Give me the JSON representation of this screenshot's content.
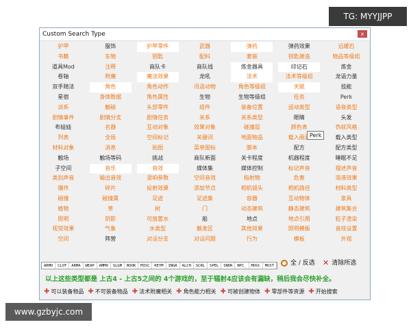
{
  "watermark_top": "TG: MYYJJPP",
  "watermark_bottom": "www.gzbyjc.com",
  "window": {
    "title": "Custom Search Type",
    "close": "x"
  },
  "rows": [
    [
      "护甲",
      "服饰",
      "护甲零件",
      "武器",
      "弹药"
    ],
    [
      "书籍",
      "东物",
      "钥匙",
      "配料",
      "套装"
    ],
    [
      "道具Mod",
      "注释",
      "商队卡",
      "商队线",
      "炼金器具"
    ],
    [
      "卷轴",
      "附魔",
      "魔法效果",
      "龙吼",
      "法术"
    ],
    [
      "双手随法",
      "角色",
      "角色动作",
      "讯语动物",
      "角色等级组"
    ],
    [
      "星宿",
      "身体数据",
      "角色属性",
      "生物",
      "生物等级组"
    ],
    [
      "派系",
      "触碰",
      "头部零件",
      "组件",
      "装备位置"
    ],
    [
      "剧情事件",
      "剧情分支",
      "剧情任务",
      "关系",
      "关系类型"
    ],
    [
      "布娃娃",
      "名器",
      "互动对象",
      "效果对象",
      "碰撞层"
    ],
    [
      "列表",
      "全局",
      "空间标记",
      "关键词",
      "地面物品"
    ],
    [
      "材料对象",
      "消息",
      "贴图",
      "菜单图标",
      "脚本"
    ],
    [
      "触场",
      "触场等码",
      "挑战",
      "商队新面",
      "关卡程度"
    ],
    [
      "子空间",
      "音乐",
      "音效",
      "媒体集",
      "媒体控制"
    ],
    [
      "类别声音",
      "输出音效",
      "混响参数",
      "空间音效",
      "指射物"
    ],
    [
      "爆炸",
      "碎片",
      "投射效果",
      "添加节点",
      "相机镜头"
    ],
    [
      "碰撞",
      "碰撞属",
      "足迹",
      "足迹集",
      "容器"
    ],
    [
      "植物",
      "草",
      "树",
      "门",
      "动态建筑"
    ],
    [
      "照明",
      "阴影",
      "可放置水",
      "船",
      "地点"
    ],
    [
      "视觉效果",
      "气象",
      "水类型",
      "触发区",
      "其他效果"
    ],
    [
      "空间",
      "阵营",
      "对话分支",
      "对话问题",
      "行为"
    ]
  ],
  "rows2": [
    [
      "弹药效果",
      "远缓石"
    ],
    [
      "钥匙建造",
      "物品等级组"
    ],
    [
      "印记石",
      "炼金"
    ],
    [
      "法术等级组",
      "龙语力量"
    ],
    [
      "天赋",
      "技能"
    ],
    [
      "任务",
      "Perk"
    ],
    [
      "运动类型",
      "语音类型"
    ],
    [
      "眼睛",
      "头发"
    ],
    [
      "颜色表",
      "伪就风格"
    ],
    [
      "载入画面",
      "载入类型"
    ],
    [
      "配方",
      "配方类型"
    ],
    [
      "机器程度",
      "睡眠不足"
    ],
    [
      "标记声音",
      "描述声音"
    ],
    [
      "危害",
      "溶液效果"
    ],
    [
      "相机路径",
      "材料类型"
    ],
    [
      "互动物体",
      "家具"
    ],
    [
      "静态建筑",
      "建筑集合"
    ],
    [
      "地点引用",
      "粒子渲染"
    ],
    [
      "照明模板",
      "音效设置"
    ],
    [
      "模板",
      "外观"
    ]
  ],
  "tooltip": "Perk",
  "signatures": [
    "ARMO",
    "CLOT",
    "ARMA",
    "WEAP",
    "AMMO",
    "SLGM",
    "BOOK",
    "MISC",
    "KEYM",
    "INGR",
    "ALCH",
    "SCRL",
    "SPEL",
    "SNDR",
    "NPC_",
    "MUSC",
    "MUST"
  ],
  "toolbar": {
    "toggle_label": "全 / 反选",
    "clear_label": "清除所选"
  },
  "note": "以上这些类型都是 上古4 - 上古5之间的 4个游戏的，至于辐射4应该会有漏缺，稍后我会尽快补全。",
  "legend": [
    "可以装备物品",
    "不可装备物品",
    "法术附魔相关",
    "角色能力相关",
    "可被创建物体",
    "零部件等资源",
    "开始搜索"
  ]
}
